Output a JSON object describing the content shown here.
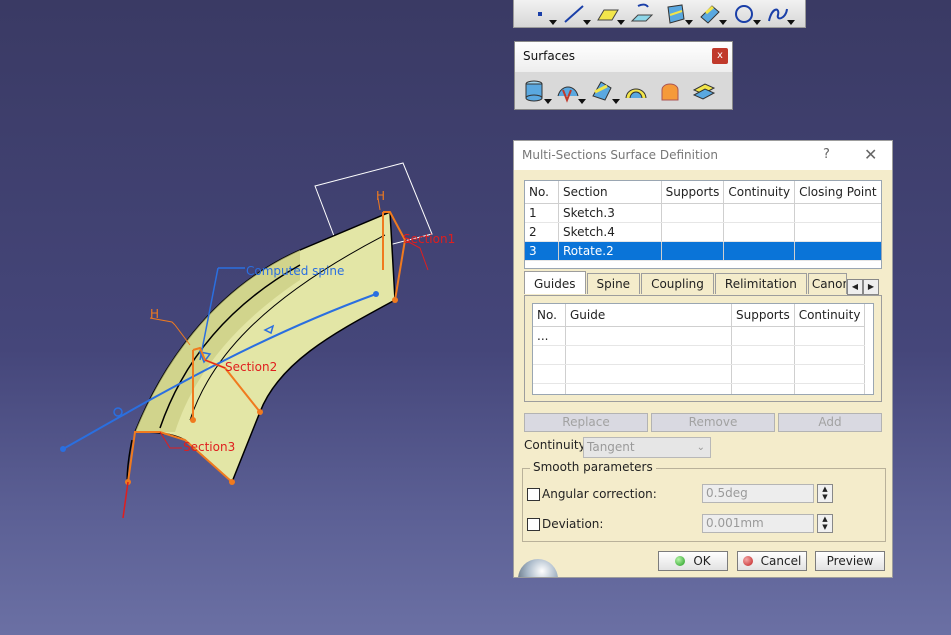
{
  "viewport": {
    "labels": {
      "computed_spine": "Computed spine",
      "section1": "Section1",
      "section2": "Section2",
      "section3": "Section3",
      "h1": "H",
      "h2": "H"
    }
  },
  "top_toolbar": {
    "icons": [
      "point-icon",
      "line-icon",
      "plane-icon",
      "projection-icon",
      "intersection-icon",
      "offset-icon",
      "circle-icon",
      "spline-icon"
    ]
  },
  "surfaces_toolbar": {
    "title": "Surfaces",
    "close": "x",
    "icons": [
      "cylinder-icon",
      "sweep-icon",
      "fill-icon",
      "multi-sections-surface-icon",
      "blend-icon",
      "offset-surface-icon"
    ]
  },
  "dialog": {
    "title": "Multi-Sections Surface Definition",
    "help": "?",
    "close": "✕",
    "sections_table": {
      "headers": [
        "No.",
        "Section",
        "Supports",
        "Continuity",
        "Closing Point"
      ],
      "rows": [
        {
          "no": "1",
          "section": "Sketch.3"
        },
        {
          "no": "2",
          "section": "Sketch.4"
        },
        {
          "no": "3",
          "section": "Rotate.2"
        }
      ]
    },
    "tabs": [
      "Guides",
      "Spine",
      "Coupling",
      "Relimitation",
      "Canonic"
    ],
    "guides_table": {
      "headers": [
        "No.",
        "Guide",
        "Supports",
        "Continuity"
      ],
      "rows": [
        {
          "no": "..."
        }
      ]
    },
    "buttons": {
      "replace": "Replace",
      "remove": "Remove",
      "add": "Add"
    },
    "continuity_label": "Continuity:",
    "continuity_value": "Tangent",
    "smooth_title": "Smooth parameters",
    "angular_label": "Angular correction:",
    "angular_value": "0.5deg",
    "deviation_label": "Deviation:",
    "deviation_value": "0.001mm",
    "ok": "OK",
    "cancel": "Cancel",
    "preview": "Preview"
  },
  "colors": {
    "background": "#45467a",
    "surface": "#e4e7a9",
    "spine": "#2a6fe0",
    "section_orange": "#f07a1e",
    "section_red": "#e01e1e",
    "selection": "#0a74d8",
    "dialog_bg": "#f4eccb"
  }
}
